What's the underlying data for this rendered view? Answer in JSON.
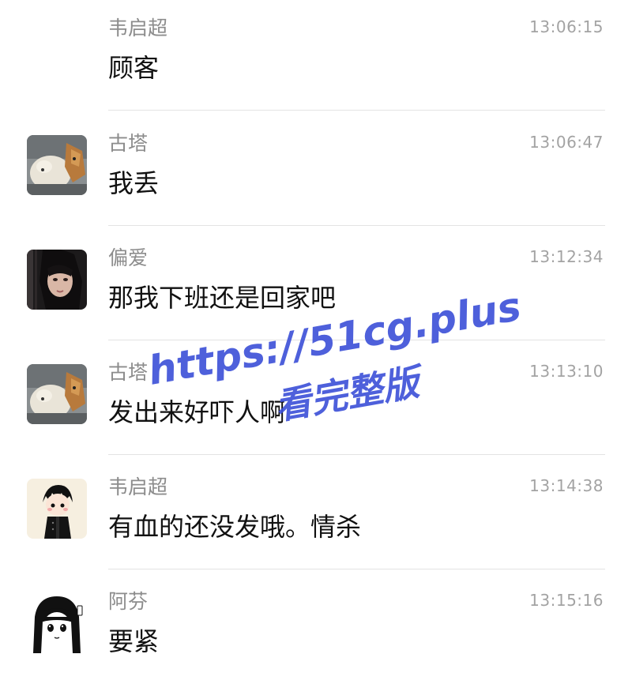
{
  "messages": [
    {
      "sender": "韦启超",
      "time": "13:06:15",
      "text": "顾客",
      "avatar": "none"
    },
    {
      "sender": "古塔",
      "time": "13:06:47",
      "text": "我丢",
      "avatar": "cat-dog-photo"
    },
    {
      "sender": "偏爱",
      "time": "13:12:34",
      "text": "那我下班还是回家吧",
      "avatar": "girl-photo"
    },
    {
      "sender": "古塔",
      "time": "13:13:10",
      "text": "发出来好吓人啊",
      "avatar": "cat-dog-photo"
    },
    {
      "sender": "韦启超",
      "time": "13:14:38",
      "text": "有血的还没发哦。情杀",
      "avatar": "anime-boy-illustration"
    },
    {
      "sender": "阿芬",
      "time": "13:15:16",
      "text": "要紧",
      "avatar": "anime-girl-sketch"
    }
  ],
  "watermark": {
    "line1": "https://51cg.plus",
    "line2": "看完整版",
    "color": "#3b4fd8"
  }
}
